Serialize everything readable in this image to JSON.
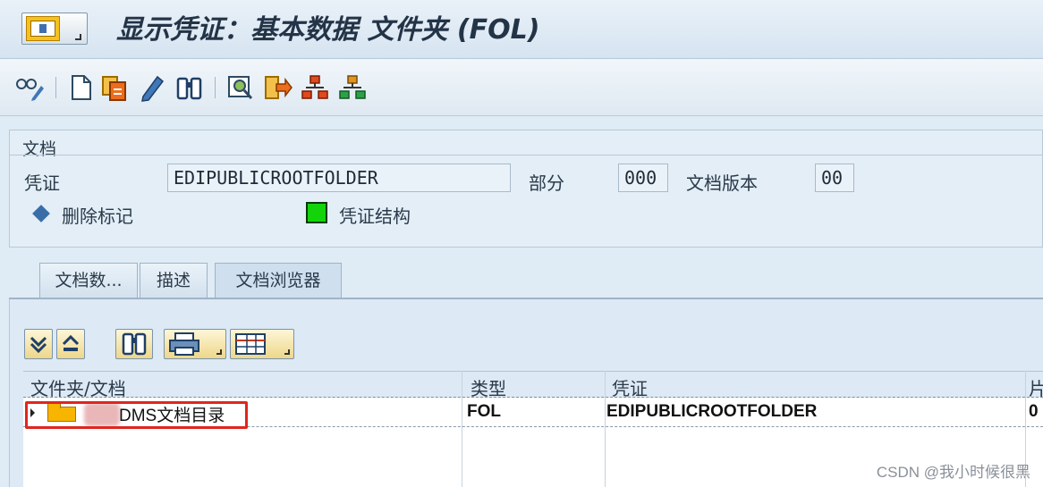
{
  "window": {
    "title": "显示凭证：基本数据 文件夹 (FOL)"
  },
  "toolbar": {
    "icons": [
      "glasses-pencil-icon",
      "new-document-icon",
      "copy-document-icon",
      "pencil-icon",
      "binoculars-icon",
      "magnifier-icon",
      "transfer-icon",
      "structure-red-icon",
      "structure-green-icon"
    ]
  },
  "header": {
    "group_title": "文档",
    "document_label": "凭证",
    "document_value": "EDIPUBLICROOTFOLDER",
    "part_label": "部分",
    "part_value": "000",
    "version_label": "文档版本",
    "version_value": "00",
    "deletion_flag_label": "删除标记",
    "doc_structure_label": "凭证结构"
  },
  "tabs": [
    {
      "label": "文档数...",
      "active": false
    },
    {
      "label": "描述",
      "active": false
    },
    {
      "label": "文档浏览器",
      "active": true
    }
  ],
  "tree": {
    "columns": [
      "文件夹/文档",
      "类型",
      "凭证",
      "片"
    ],
    "rows": [
      {
        "name": "DMS文档目录",
        "type": "FOL",
        "document": "EDIPUBLICROOTFOLDER",
        "extra": "0"
      }
    ]
  },
  "watermark": "CSDN @我小时候很黑",
  "colors": {
    "background": "#dfebf5",
    "highlight": "#e0261d",
    "status_green": "#13d40b",
    "folder": "#f7b500"
  }
}
